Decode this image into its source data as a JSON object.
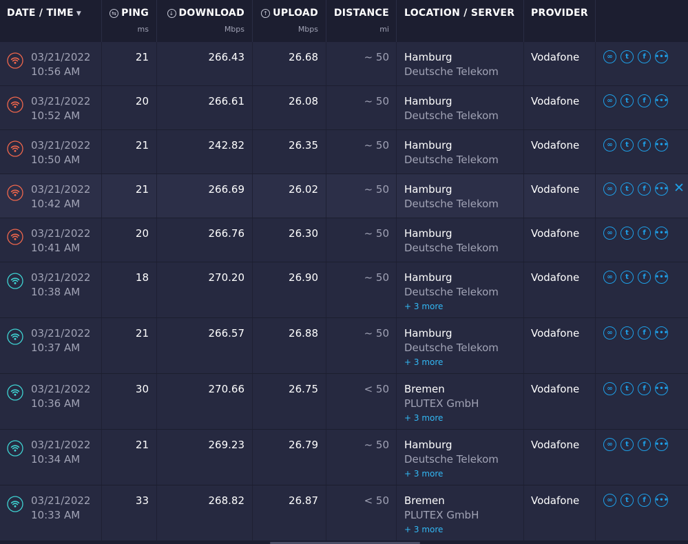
{
  "header": {
    "datetime": "DATE / TIME",
    "ping": "PING",
    "ping_unit": "ms",
    "download": "DOWNLOAD",
    "download_unit": "Mbps",
    "upload": "UPLOAD",
    "upload_unit": "Mbps",
    "distance": "DISTANCE",
    "distance_unit": "mi",
    "location": "LOCATION / SERVER",
    "provider": "PROVIDER"
  },
  "colors": {
    "wifi_warning": "#f0674c",
    "wifi_good": "#3fd4d3",
    "accent": "#1ea0e8"
  },
  "icons": {
    "share": [
      "link-icon",
      "twitter-icon",
      "facebook-icon",
      "more-icon"
    ],
    "sort": "sort-desc-icon",
    "close": "close-icon"
  },
  "rows": [
    {
      "date": "03/21/2022",
      "time": "10:56 AM",
      "ping": "21",
      "download": "266.43",
      "upload": "26.68",
      "distance": "~ 50",
      "city": "Hamburg",
      "server": "Deutsche Telekom",
      "provider": "Vodafone",
      "more": "",
      "wifi": "warning"
    },
    {
      "date": "03/21/2022",
      "time": "10:52 AM",
      "ping": "20",
      "download": "266.61",
      "upload": "26.08",
      "distance": "~ 50",
      "city": "Hamburg",
      "server": "Deutsche Telekom",
      "provider": "Vodafone",
      "more": "",
      "wifi": "warning"
    },
    {
      "date": "03/21/2022",
      "time": "10:50 AM",
      "ping": "21",
      "download": "242.82",
      "upload": "26.35",
      "distance": "~ 50",
      "city": "Hamburg",
      "server": "Deutsche Telekom",
      "provider": "Vodafone",
      "more": "",
      "wifi": "warning"
    },
    {
      "date": "03/21/2022",
      "time": "10:42 AM",
      "ping": "21",
      "download": "266.69",
      "upload": "26.02",
      "distance": "~ 50",
      "city": "Hamburg",
      "server": "Deutsche Telekom",
      "provider": "Vodafone",
      "more": "",
      "wifi": "warning",
      "selected": true
    },
    {
      "date": "03/21/2022",
      "time": "10:41 AM",
      "ping": "20",
      "download": "266.76",
      "upload": "26.30",
      "distance": "~ 50",
      "city": "Hamburg",
      "server": "Deutsche Telekom",
      "provider": "Vodafone",
      "more": "",
      "wifi": "warning"
    },
    {
      "date": "03/21/2022",
      "time": "10:38 AM",
      "ping": "18",
      "download": "270.20",
      "upload": "26.90",
      "distance": "~ 50",
      "city": "Hamburg",
      "server": "Deutsche Telekom",
      "provider": "Vodafone",
      "more": "+ 3 more",
      "wifi": "good"
    },
    {
      "date": "03/21/2022",
      "time": "10:37 AM",
      "ping": "21",
      "download": "266.57",
      "upload": "26.88",
      "distance": "~ 50",
      "city": "Hamburg",
      "server": "Deutsche Telekom",
      "provider": "Vodafone",
      "more": "+ 3 more",
      "wifi": "good"
    },
    {
      "date": "03/21/2022",
      "time": "10:36 AM",
      "ping": "30",
      "download": "270.66",
      "upload": "26.75",
      "distance": "< 50",
      "city": "Bremen",
      "server": "PLUTEX GmbH",
      "provider": "Vodafone",
      "more": "+ 3 more",
      "wifi": "good"
    },
    {
      "date": "03/21/2022",
      "time": "10:34 AM",
      "ping": "21",
      "download": "269.23",
      "upload": "26.79",
      "distance": "~ 50",
      "city": "Hamburg",
      "server": "Deutsche Telekom",
      "provider": "Vodafone",
      "more": "+ 3 more",
      "wifi": "good"
    },
    {
      "date": "03/21/2022",
      "time": "10:33 AM",
      "ping": "33",
      "download": "268.82",
      "upload": "26.87",
      "distance": "< 50",
      "city": "Bremen",
      "server": "PLUTEX GmbH",
      "provider": "Vodafone",
      "more": "+ 3 more",
      "wifi": "good"
    }
  ]
}
